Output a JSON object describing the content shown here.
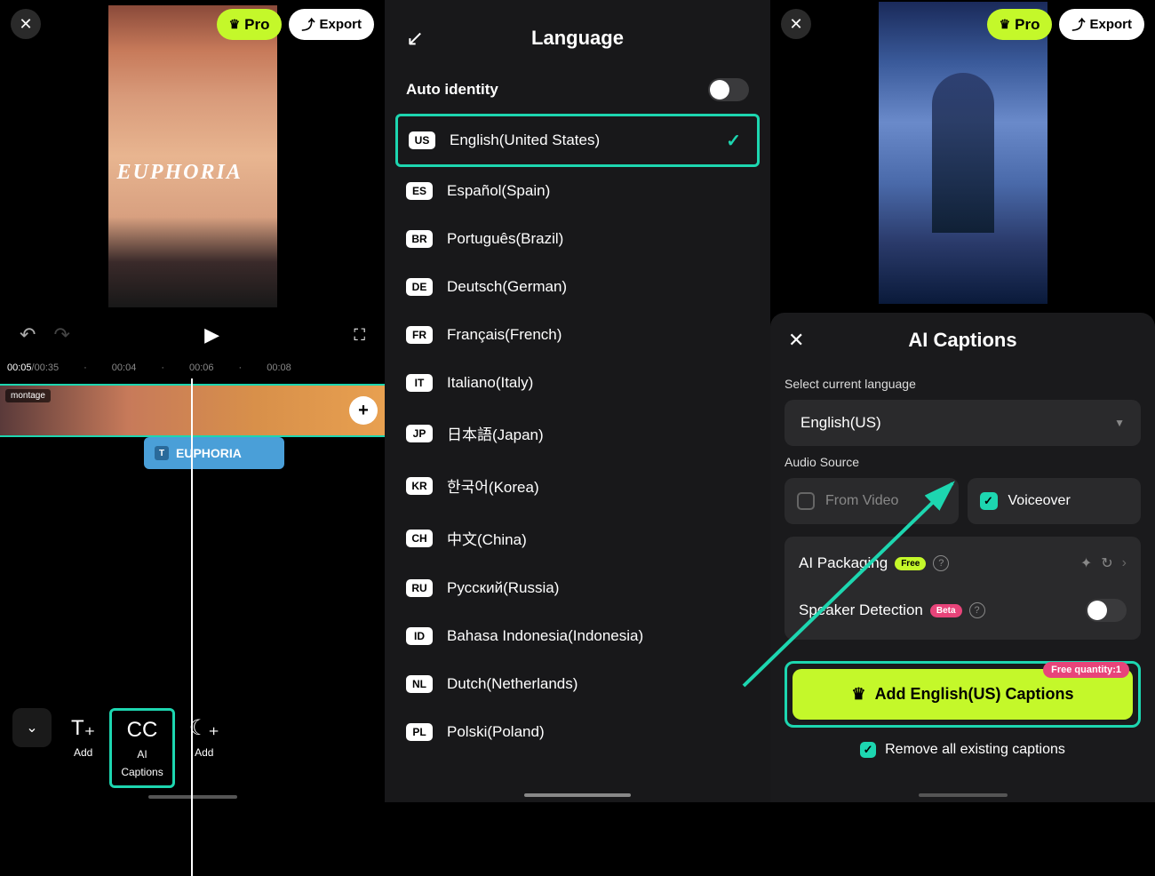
{
  "panel1": {
    "pro_label": "Pro",
    "export_label": "Export",
    "video_text": "EUPHORIA",
    "time_current": "00:05",
    "time_total": "/00:35",
    "ruler": [
      "00:04",
      "00:06",
      "00:08"
    ],
    "montage_tag": "montage",
    "text_clip_label": "EUPHORIA",
    "tools": {
      "add": "Add",
      "ai_captions_l1": "AI",
      "ai_captions_l2": "Captions",
      "add2": "Add"
    }
  },
  "panel2": {
    "title": "Language",
    "auto_identity": "Auto identity",
    "langs": [
      {
        "code": "US",
        "name": "English(United States)",
        "selected": true
      },
      {
        "code": "ES",
        "name": "Español(Spain)"
      },
      {
        "code": "BR",
        "name": "Português(Brazil)"
      },
      {
        "code": "DE",
        "name": "Deutsch(German)"
      },
      {
        "code": "FR",
        "name": "Français(French)"
      },
      {
        "code": "IT",
        "name": "Italiano(Italy)"
      },
      {
        "code": "JP",
        "name": "日本語(Japan)"
      },
      {
        "code": "KR",
        "name": "한국어(Korea)"
      },
      {
        "code": "CH",
        "name": "中文(China)"
      },
      {
        "code": "RU",
        "name": "Русский(Russia)"
      },
      {
        "code": "ID",
        "name": "Bahasa Indonesia(Indonesia)"
      },
      {
        "code": "NL",
        "name": "Dutch(Netherlands)"
      },
      {
        "code": "PL",
        "name": "Polski(Poland)"
      }
    ]
  },
  "panel3": {
    "pro_label": "Pro",
    "export_label": "Export",
    "sheet_title": "AI Captions",
    "select_lang_label": "Select current language",
    "selected_lang": "English(US)",
    "audio_source_label": "Audio Source",
    "from_video": "From Video",
    "voiceover": "Voiceover",
    "ai_packaging": "AI Packaging",
    "free_badge": "Free",
    "speaker_detection": "Speaker Detection",
    "beta_badge": "Beta",
    "cta_label": "Add English(US) Captions",
    "free_quantity": "Free quantity:1",
    "remove_label": "Remove all existing captions"
  }
}
